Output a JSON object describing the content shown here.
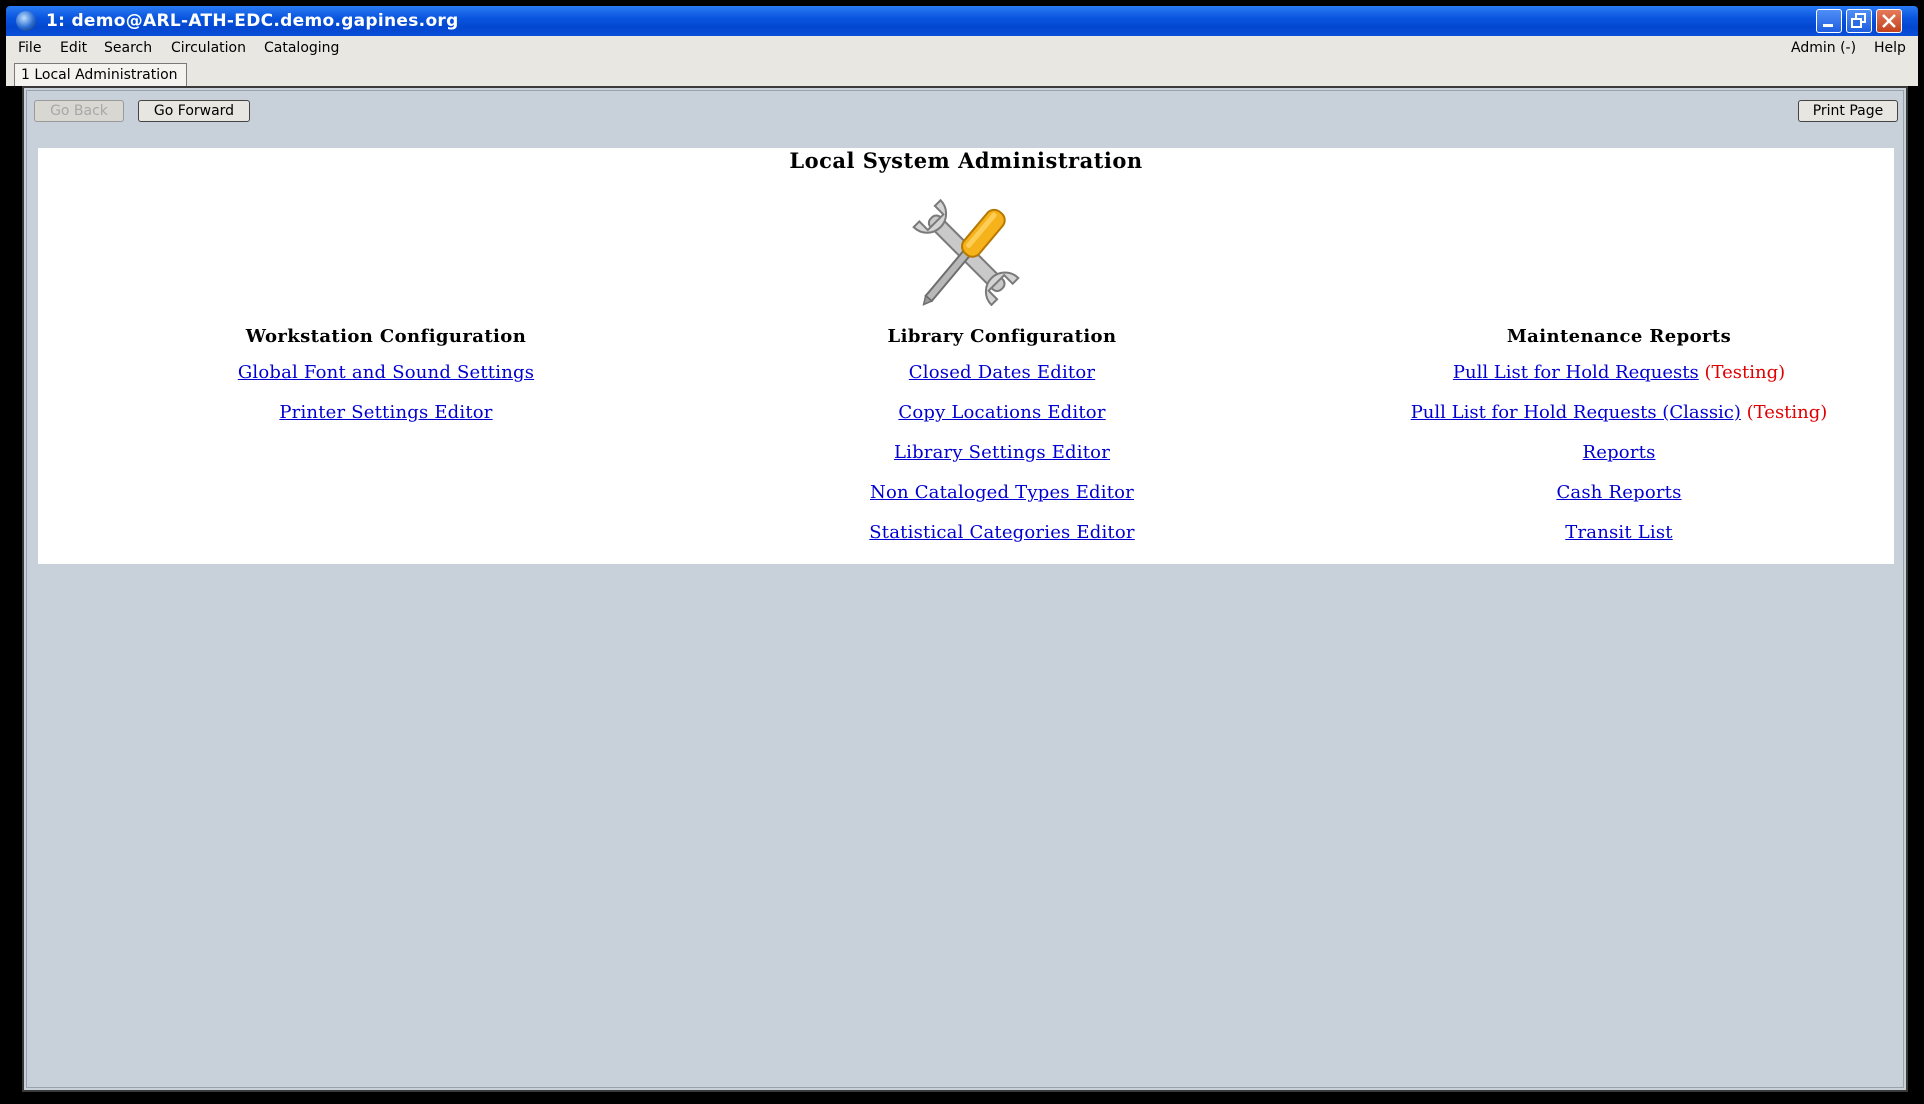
{
  "window": {
    "title": "1: demo@ARL-ATH-EDC.demo.gapines.org",
    "accent": "#0a55de"
  },
  "menubar": {
    "left": [
      {
        "label": "File"
      },
      {
        "label": "Edit"
      },
      {
        "label": "Search"
      },
      {
        "label": "Circulation"
      },
      {
        "label": "Cataloging"
      }
    ],
    "right": [
      {
        "label": "Admin (-)"
      },
      {
        "label": "Help"
      }
    ]
  },
  "tabs": [
    {
      "label": "1 Local Administration",
      "active": true
    }
  ],
  "toolbar": {
    "back_label": "Go Back",
    "forward_label": "Go Forward",
    "print_label": "Print Page"
  },
  "page": {
    "title": "Local System Administration",
    "logo_icon": "wrench-screwdriver-icon",
    "columns": [
      {
        "heading": "Workstation Configuration",
        "links": [
          {
            "label": "Global Font and Sound Settings"
          },
          {
            "label": "Printer Settings Editor"
          }
        ]
      },
      {
        "heading": "Library Configuration",
        "links": [
          {
            "label": "Closed Dates Editor"
          },
          {
            "label": "Copy Locations Editor"
          },
          {
            "label": "Library Settings Editor"
          },
          {
            "label": "Non Cataloged Types Editor"
          },
          {
            "label": "Statistical Categories Editor"
          }
        ]
      },
      {
        "heading": "Maintenance Reports",
        "links": [
          {
            "label": "Pull List for Hold Requests",
            "note": "(Testing)"
          },
          {
            "label": "Pull List for Hold Requests (Classic)",
            "note": "(Testing)"
          },
          {
            "label": "Reports"
          },
          {
            "label": "Cash Reports"
          },
          {
            "label": "Transit List"
          }
        ]
      }
    ],
    "link_color": "#0000d0",
    "note_color": "#e00000"
  }
}
